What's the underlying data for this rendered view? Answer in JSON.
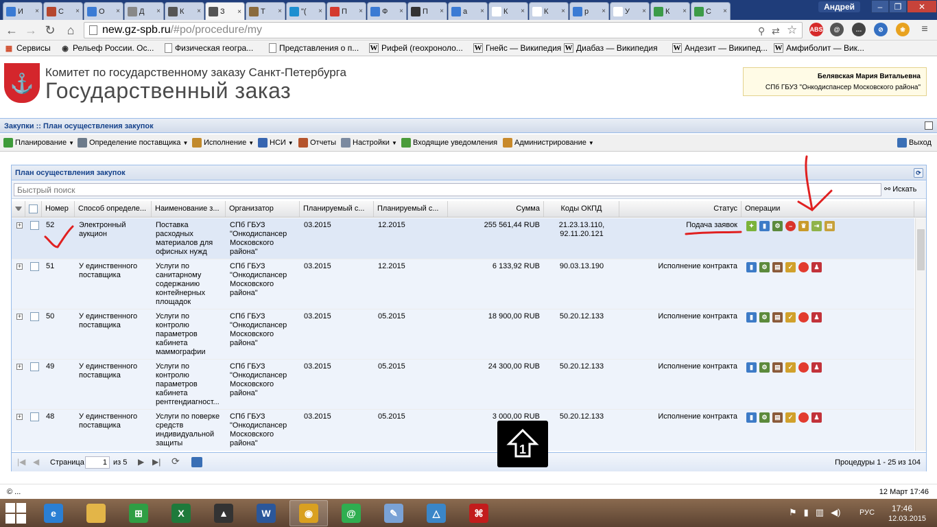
{
  "browser": {
    "tabs": [
      {
        "label": "И",
        "icon": "globe-icon",
        "color": "#3b7bd4"
      },
      {
        "label": "С",
        "icon": "coat-of-arms-icon",
        "color": "#b5472e"
      },
      {
        "label": "О",
        "icon": "globe-icon",
        "color": "#3b7bd4"
      },
      {
        "label": "Д",
        "icon": "star-icon",
        "color": "#888888"
      },
      {
        "label": "К",
        "icon": "hammer-icon",
        "color": "#555555"
      },
      {
        "label": "З",
        "icon": "hammer-icon",
        "color": "#555555"
      },
      {
        "label": "Т",
        "icon": "map-icon",
        "color": "#8a6b3d"
      },
      {
        "label": "\"(",
        "icon": "s-icon",
        "color": "#1d8fd0"
      },
      {
        "label": "П",
        "icon": "ru-icon",
        "color": "#d43b2f"
      },
      {
        "label": "Ф",
        "icon": "globe-icon",
        "color": "#3b7bd4"
      },
      {
        "label": "П",
        "icon": "igk-icon",
        "color": "#333333"
      },
      {
        "label": "а",
        "icon": "google-icon",
        "color": "#3b7bd4"
      },
      {
        "label": "К",
        "icon": "page-icon",
        "color": "#ffffff"
      },
      {
        "label": "К",
        "icon": "page-icon",
        "color": "#ffffff"
      },
      {
        "label": "р",
        "icon": "google-icon",
        "color": "#3b7bd4"
      },
      {
        "label": "У",
        "icon": "none",
        "color": "#ffffff"
      },
      {
        "label": "К",
        "icon": "green-star-icon",
        "color": "#3c9b48"
      },
      {
        "label": "С",
        "icon": "green-star-icon",
        "color": "#3c9b48"
      }
    ],
    "active_tab_index": 5,
    "user": "Андрей",
    "url_host": "new.gz-spb.ru",
    "url_path": "/#po/procedure/my",
    "bookmarks": [
      {
        "label": "Сервисы",
        "icon": "apps-icon"
      },
      {
        "label": "Рельеф России. Ос...",
        "icon": "globe-icon"
      },
      {
        "label": "Физическая геогра...",
        "icon": "page-icon"
      },
      {
        "label": "Представления о п...",
        "icon": "page-icon"
      },
      {
        "label": "Рифей (геохроноло...",
        "icon": "wikipedia-icon"
      },
      {
        "label": "Гнейс — Википедия",
        "icon": "wikipedia-icon"
      },
      {
        "label": "Диабаз — Википедия",
        "icon": "wikipedia-icon"
      },
      {
        "label": "Андезит — Википед...",
        "icon": "wikipedia-icon"
      },
      {
        "label": "Амфиболит — Вик...",
        "icon": "wikipedia-icon"
      }
    ]
  },
  "site": {
    "org": "Комитет по государственному заказу Санкт-Петербурга",
    "title": "Государственный заказ",
    "user_name": "Белявская Мария Витальевна",
    "user_org": "СПб ГБУЗ \"Онкодиспансер Московского района\""
  },
  "app": {
    "breadcrumb": "Закупки :: План осуществления закупок",
    "menu": [
      {
        "label": "Планирование",
        "dropdown": true,
        "icon": "planning-icon"
      },
      {
        "label": "Определение поставщика",
        "dropdown": true,
        "icon": "gears-icon"
      },
      {
        "label": "Исполнение",
        "dropdown": true,
        "icon": "execution-icon"
      },
      {
        "label": "НСИ",
        "dropdown": true,
        "icon": "reference-icon"
      },
      {
        "label": "Отчеты",
        "dropdown": false,
        "icon": "report-icon"
      },
      {
        "label": "Настройки",
        "dropdown": true,
        "icon": "wrench-icon"
      },
      {
        "label": "Входящие уведомления",
        "dropdown": false,
        "icon": "inbox-icon"
      },
      {
        "label": "Администрирование",
        "dropdown": true,
        "icon": "admin-icon"
      }
    ],
    "logout": "Выход"
  },
  "grid": {
    "title": "План осуществления закупок",
    "search_placeholder": "Быстрый поиск",
    "search_button": "Искать",
    "columns": [
      "Номер",
      "Способ определе...",
      "Наименование з...",
      "Организатор",
      "Планируемый с...",
      "Планируемый с...",
      "Сумма",
      "Коды ОКПД",
      "Статус",
      "Операции"
    ],
    "rows": [
      {
        "num": "52",
        "method": "Электронный аукцион",
        "name": "Поставка расходных материалов для офисных нужд",
        "org": "СПб ГБУЗ \"Онкодиспансер Московского района\"",
        "start": "03.2015",
        "end": "12.2015",
        "sum": "255 561,44 RUB",
        "okpd": "21.23.13.110, 92.11.20.121",
        "status": "Подача заявок",
        "ops": [
          "tag-icon",
          "chart-icon",
          "gears-icon",
          "cancel-icon",
          "emblem-icon",
          "export-icon",
          "scroll-icon"
        ]
      },
      {
        "num": "51",
        "method": "У единственного поставщика",
        "name": "Услуги по санитарному содержанию контейнерных площадок",
        "org": "СПб ГБУЗ \"Онкодиспансер Московского района\"",
        "start": "03.2015",
        "end": "12.2015",
        "sum": "6 133,92 RUB",
        "okpd": "90.03.13.190",
        "status": "Исполнение контракта",
        "ops": [
          "chart-icon",
          "gears-icon",
          "document-icon",
          "certificate-icon",
          "red-dot-icon",
          "users-icon"
        ]
      },
      {
        "num": "50",
        "method": "У единственного поставщика",
        "name": "Услуги по контролю параметров кабинета маммографии",
        "org": "СПб ГБУЗ \"Онкодиспансер Московского района\"",
        "start": "03.2015",
        "end": "05.2015",
        "sum": "18 900,00 RUB",
        "okpd": "50.20.12.133",
        "status": "Исполнение контракта",
        "ops": [
          "chart-icon",
          "gears-icon",
          "document-icon",
          "certificate-icon",
          "red-dot-icon",
          "users-icon"
        ]
      },
      {
        "num": "49",
        "method": "У единственного поставщика",
        "name": "Услуги по контролю параметров кабинета рентгендиагност...",
        "org": "СПб ГБУЗ \"Онкодиспансер Московского района\"",
        "start": "03.2015",
        "end": "05.2015",
        "sum": "24 300,00 RUB",
        "okpd": "50.20.12.133",
        "status": "Исполнение контракта",
        "ops": [
          "chart-icon",
          "gears-icon",
          "document-icon",
          "certificate-icon",
          "red-dot-icon",
          "users-icon"
        ]
      },
      {
        "num": "48",
        "method": "У единственного поставщика",
        "name": "Услуги по поверке средств индивидуальной защиты",
        "org": "СПб ГБУЗ \"Онкодиспансер Московского района\"",
        "start": "03.2015",
        "end": "05.2015",
        "sum": "3 000,00 RUB",
        "okpd": "50.20.12.133",
        "status": "Исполнение контракта",
        "ops": [
          "chart-icon",
          "gears-icon",
          "document-icon",
          "certificate-icon",
          "red-dot-icon",
          "users-icon"
        ]
      }
    ],
    "pager": {
      "page_label": "Страница",
      "page": "1",
      "of": "из 5",
      "summary": "Процедуры 1 - 25 из 104"
    }
  },
  "status": {
    "left": "© ...",
    "right": "12 Март 17:46"
  },
  "taskbar": {
    "apps": [
      {
        "name": "ie-icon",
        "color": "#2a7fd4",
        "glyph": "e"
      },
      {
        "name": "folder-icon",
        "color": "#e3b548",
        "glyph": ""
      },
      {
        "name": "store-icon",
        "color": "#2f9e44",
        "glyph": "⊞"
      },
      {
        "name": "excel-icon",
        "color": "#1e7a3b",
        "glyph": "X"
      },
      {
        "name": "graduation-icon",
        "color": "#333333",
        "glyph": "▲"
      },
      {
        "name": "word-icon",
        "color": "#2b579a",
        "glyph": "W"
      },
      {
        "name": "chrome-icon",
        "color": "#d9a020",
        "glyph": "◉"
      },
      {
        "name": "mail-agent-icon",
        "color": "#2fae50",
        "glyph": "@"
      },
      {
        "name": "paint-icon",
        "color": "#7aa2d6",
        "glyph": "✎"
      },
      {
        "name": "drive-icon",
        "color": "#3a86c8",
        "glyph": "△"
      },
      {
        "name": "pdf-icon",
        "color": "#c21c1c",
        "glyph": "⌘"
      }
    ],
    "active_app_index": 6,
    "lang": "РУС",
    "time": "17:46",
    "date": "12.03.2015"
  },
  "annotation": {
    "badge_digit": "1"
  }
}
